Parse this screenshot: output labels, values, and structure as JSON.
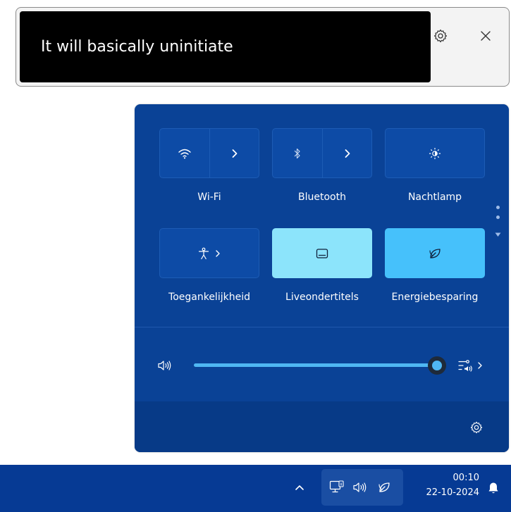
{
  "caption_window": {
    "text": "It will basically uninitiate",
    "icons": [
      "settings-gear-icon",
      "close-icon"
    ]
  },
  "quick_settings": {
    "tiles": [
      {
        "label": "Wi-Fi",
        "icon": "wifi-icon",
        "has_arrow": true,
        "active": false
      },
      {
        "label": "Bluetooth",
        "icon": "bluetooth-icon",
        "has_arrow": true,
        "active": false
      },
      {
        "label": "Nachtlamp",
        "icon": "night-light-icon",
        "has_arrow": false,
        "active": false
      },
      {
        "label": "Toegankelijkheid",
        "icon": "accessibility-icon",
        "has_arrow": true,
        "active": false
      },
      {
        "label": "Liveondertitels",
        "icon": "live-captions-icon",
        "has_arrow": false,
        "active": true
      },
      {
        "label": "Energiebesparing",
        "icon": "energy-saver-leaf-icon",
        "has_arrow": false,
        "active": true
      }
    ],
    "volume": {
      "level_fraction": 0.99,
      "icon": "speaker-icon",
      "output_icon": "audio-output-icon"
    },
    "footer_icon": "settings-gear-icon"
  },
  "taskbar": {
    "time": "00:10",
    "date": "22-10-2024",
    "icons": [
      "chevron-up-icon",
      "network-icon",
      "speaker-icon",
      "energy-saver-leaf-icon",
      "notification-bell-icon"
    ]
  },
  "colors": {
    "panel_bg": "#0a4296",
    "tile_bg": "#0d4ba6",
    "active_light": "#8ce4fb",
    "active_mid": "#46c1fb",
    "taskbar_bg": "#063a94",
    "accent": "#4fb7f3"
  }
}
